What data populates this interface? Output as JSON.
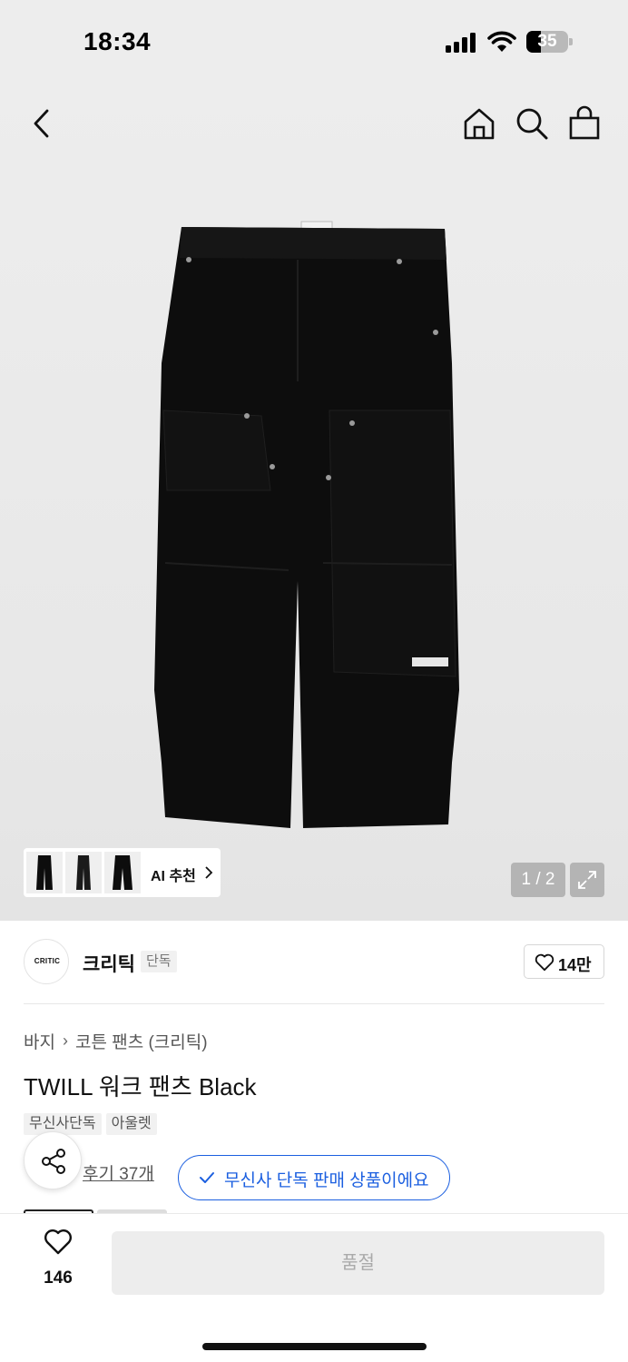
{
  "status_bar": {
    "time": "18:34",
    "battery": "35",
    "battery_level": 0.35
  },
  "nav": {
    "back": "chevron-left-icon",
    "home": "home-icon",
    "search": "search-icon",
    "cart": "shopping-bag-icon"
  },
  "gallery": {
    "ai_label": "AI 추천",
    "pager": "1 / 2"
  },
  "brand": {
    "logo_text": "CRITIC",
    "name": "크리틱",
    "tag": "단독",
    "follow_count": "14만"
  },
  "breadcrumb": {
    "items": [
      "바지",
      "코튼 팬츠 (크리틱)"
    ]
  },
  "product": {
    "title": "TWILL 워크 팬츠 Black",
    "badges": [
      "무신사단독",
      "아울렛"
    ],
    "review_link": "후기 37개",
    "exclusive_pill": "무신사 단독 판매 상품이에요"
  },
  "bottom": {
    "like_count": "146",
    "buy_label": "품절"
  },
  "colors": {
    "accent_blue": "#1b5fe0",
    "soldout_bg": "#ededed"
  }
}
